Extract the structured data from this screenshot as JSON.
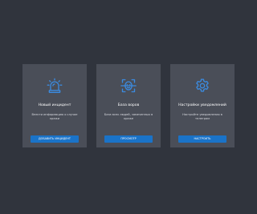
{
  "cards": [
    {
      "title": "Новый инцидент",
      "description": "Внести информацию о случае кражи",
      "button_label": "ДОБАВИТЬ ИНЦИДЕНТ",
      "icon": "alarm-siren-icon"
    },
    {
      "title": "База воров",
      "description": "База всех людей, замеченных в краже",
      "button_label": "ПРОСМОТР",
      "icon": "face-scan-icon"
    },
    {
      "title": "Настройки уведомлений",
      "description": "Настройте уведомления в телеграм",
      "button_label": "НАСТРОИТЬ",
      "icon": "gear-icon"
    }
  ],
  "colors": {
    "background": "#30343d",
    "card": "#4a4e58",
    "accent": "#1a73c8",
    "icon": "#3b8be0"
  }
}
